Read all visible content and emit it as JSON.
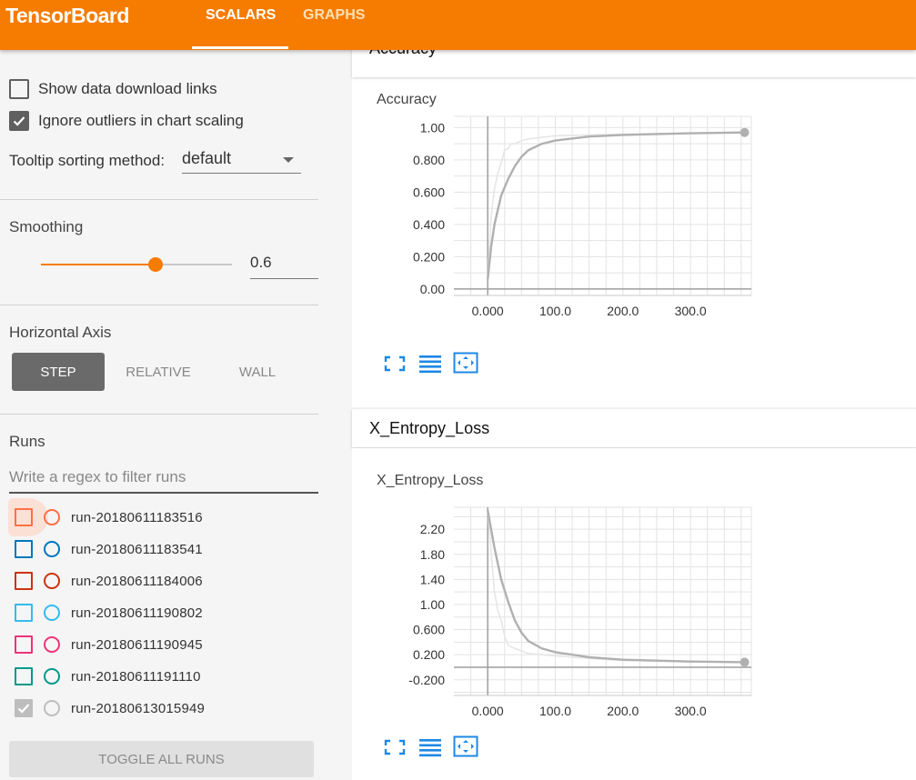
{
  "header": {
    "brand": "TensorBoard",
    "tabs": [
      {
        "label": "SCALARS",
        "active": true
      },
      {
        "label": "GRAPHS",
        "active": false
      }
    ],
    "color": "#f57c00"
  },
  "sidebar": {
    "show_download_links": {
      "label": "Show data download links",
      "checked": false
    },
    "ignore_outliers": {
      "label": "Ignore outliers in chart scaling",
      "checked": true
    },
    "tooltip_sorting": {
      "label": "Tooltip sorting method:",
      "value": "default"
    },
    "smoothing": {
      "title": "Smoothing",
      "value": "0.6",
      "fraction": 0.6
    },
    "horizontal_axis": {
      "title": "Horizontal Axis",
      "options": [
        {
          "label": "STEP",
          "active": true
        },
        {
          "label": "RELATIVE",
          "active": false
        },
        {
          "label": "WALL",
          "active": false
        }
      ]
    },
    "runs": {
      "title": "Runs",
      "filter_placeholder": "Write a regex to filter runs",
      "items": [
        {
          "name": "run-20180611183516",
          "color": "#ff7043",
          "checked": false
        },
        {
          "name": "run-20180611183541",
          "color": "#0077bb",
          "checked": false
        },
        {
          "name": "run-20180611184006",
          "color": "#cc3311",
          "checked": false
        },
        {
          "name": "run-20180611190802",
          "color": "#33bbee",
          "checked": false
        },
        {
          "name": "run-20180611190945",
          "color": "#ee3377",
          "checked": false
        },
        {
          "name": "run-20180611191110",
          "color": "#009988",
          "checked": false
        },
        {
          "name": "run-20180613015949",
          "color": "#bbbbbb",
          "checked": true
        }
      ],
      "toggle_label": "TOGGLE ALL RUNS"
    }
  },
  "main": {
    "cards": [
      {
        "header": "Accuracy",
        "chart_title": "Accuracy"
      },
      {
        "header": "X_Entropy_Loss",
        "chart_title": "X_Entropy_Loss"
      }
    ]
  },
  "chart_data": [
    {
      "type": "line",
      "title": "Accuracy",
      "xlabel": "",
      "ylabel": "",
      "xlim": [
        -50,
        390
      ],
      "ylim": [
        -0.04,
        1.07
      ],
      "x_ticks": [
        "0.000",
        "100.0",
        "200.0",
        "300.0"
      ],
      "y_ticks": [
        "0.00",
        "0.200",
        "0.400",
        "0.600",
        "0.800",
        "1.00"
      ],
      "grid": true,
      "series": [
        {
          "role": "smoothed",
          "color": "#b0b0b0",
          "x": [
            0,
            5,
            10,
            20,
            30,
            40,
            50,
            60,
            80,
            100,
            150,
            200,
            300,
            380
          ],
          "y": [
            0.06,
            0.26,
            0.4,
            0.58,
            0.68,
            0.76,
            0.82,
            0.86,
            0.9,
            0.92,
            0.945,
            0.955,
            0.965,
            0.97
          ]
        },
        {
          "role": "raw",
          "color": "#e6e6e6",
          "x": [
            0,
            5,
            10,
            15,
            20,
            25,
            30,
            35,
            40,
            50,
            60,
            80,
            100,
            150,
            200,
            300,
            380
          ],
          "y": [
            0.06,
            0.45,
            0.62,
            0.72,
            0.78,
            0.86,
            0.87,
            0.9,
            0.9,
            0.92,
            0.93,
            0.94,
            0.95,
            0.955,
            0.96,
            0.965,
            0.97
          ]
        }
      ]
    },
    {
      "type": "line",
      "title": "X_Entropy_Loss",
      "xlabel": "",
      "ylabel": "",
      "xlim": [
        -50,
        390
      ],
      "ylim": [
        -0.45,
        2.55
      ],
      "x_ticks": [
        "0.000",
        "100.0",
        "200.0",
        "300.0"
      ],
      "y_ticks": [
        "-0.200",
        "0.200",
        "0.600",
        "1.00",
        "1.40",
        "1.80",
        "2.20"
      ],
      "grid": true,
      "series": [
        {
          "role": "smoothed",
          "color": "#b0b0b0",
          "x": [
            0,
            10,
            20,
            30,
            40,
            50,
            60,
            80,
            100,
            150,
            200,
            300,
            380
          ],
          "y": [
            2.5,
            1.9,
            1.4,
            1.05,
            0.75,
            0.55,
            0.42,
            0.3,
            0.24,
            0.16,
            0.12,
            0.09,
            0.08
          ]
        },
        {
          "role": "raw",
          "color": "#e6e6e6",
          "x": [
            0,
            10,
            15,
            20,
            25,
            30,
            40,
            50,
            60,
            80,
            100,
            150,
            200,
            300,
            380
          ],
          "y": [
            2.5,
            1.2,
            0.9,
            0.75,
            0.5,
            0.35,
            0.3,
            0.26,
            0.22,
            0.2,
            0.18,
            0.14,
            0.11,
            0.09,
            0.08
          ]
        }
      ]
    }
  ]
}
